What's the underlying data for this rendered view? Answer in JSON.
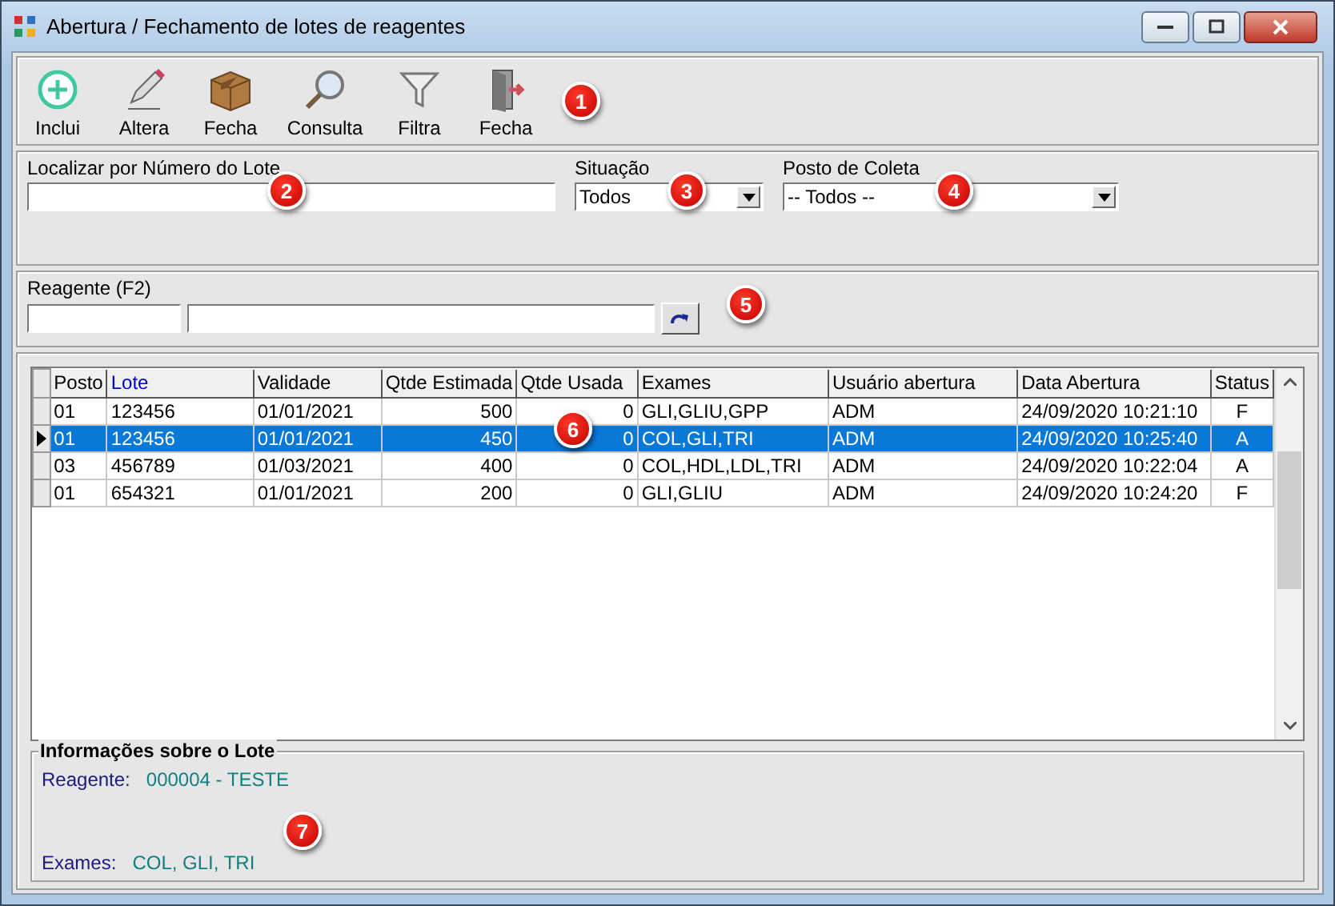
{
  "window": {
    "title": "Abertura / Fechamento de lotes de reagentes"
  },
  "toolbar": [
    {
      "label": "Inclui",
      "kind": "add"
    },
    {
      "label": "Altera",
      "kind": "edit"
    },
    {
      "label": "Fecha",
      "kind": "box"
    },
    {
      "label": "Consulta",
      "kind": "search"
    },
    {
      "label": "Filtra",
      "kind": "filter"
    },
    {
      "label": "Fecha",
      "kind": "exit"
    }
  ],
  "search": {
    "lote_label": "Localizar por Número do Lote",
    "situacao_label": "Situação",
    "situacao_value": "Todos",
    "posto_label": "Posto de Coleta",
    "posto_value": "-- Todos --"
  },
  "reagent": {
    "label": "Reagente (F2)"
  },
  "table": {
    "columns": [
      {
        "label": "Posto",
        "sorted": false
      },
      {
        "label": "Lote",
        "sorted": true
      },
      {
        "label": "Validade",
        "sorted": false
      },
      {
        "label": "Qtde Estimada",
        "sorted": false
      },
      {
        "label": "Qtde Usada",
        "sorted": false
      },
      {
        "label": "Exames",
        "sorted": false
      },
      {
        "label": "Usuário abertura",
        "sorted": false
      },
      {
        "label": "Data Abertura",
        "sorted": false
      },
      {
        "label": "Status",
        "sorted": false
      }
    ],
    "rows": [
      {
        "selected": false,
        "cells": [
          "01",
          "123456",
          "01/01/2021",
          "500",
          "0",
          "GLI,GLIU,GPP",
          "ADM",
          "24/09/2020 10:21:10",
          "F"
        ]
      },
      {
        "selected": true,
        "cells": [
          "01",
          "123456",
          "01/01/2021",
          "450",
          "0",
          "COL,GLI,TRI",
          "ADM",
          "24/09/2020 10:25:40",
          "A"
        ]
      },
      {
        "selected": false,
        "cells": [
          "03",
          "456789",
          "01/03/2021",
          "400",
          "0",
          "COL,HDL,LDL,TRI",
          "ADM",
          "24/09/2020 10:22:04",
          "A"
        ]
      },
      {
        "selected": false,
        "cells": [
          "01",
          "654321",
          "01/01/2021",
          "200",
          "0",
          "GLI,GLIU",
          "ADM",
          "24/09/2020 10:24:20",
          "F"
        ]
      }
    ]
  },
  "info": {
    "title": "Informações sobre o Lote",
    "fields": [
      {
        "label": "Reagente:",
        "value": "000004 - TESTE"
      },
      {
        "label": "Exames:",
        "value": "COL, GLI, TRI"
      }
    ]
  },
  "callouts": [
    "1",
    "2",
    "3",
    "4",
    "5",
    "6",
    "7"
  ]
}
